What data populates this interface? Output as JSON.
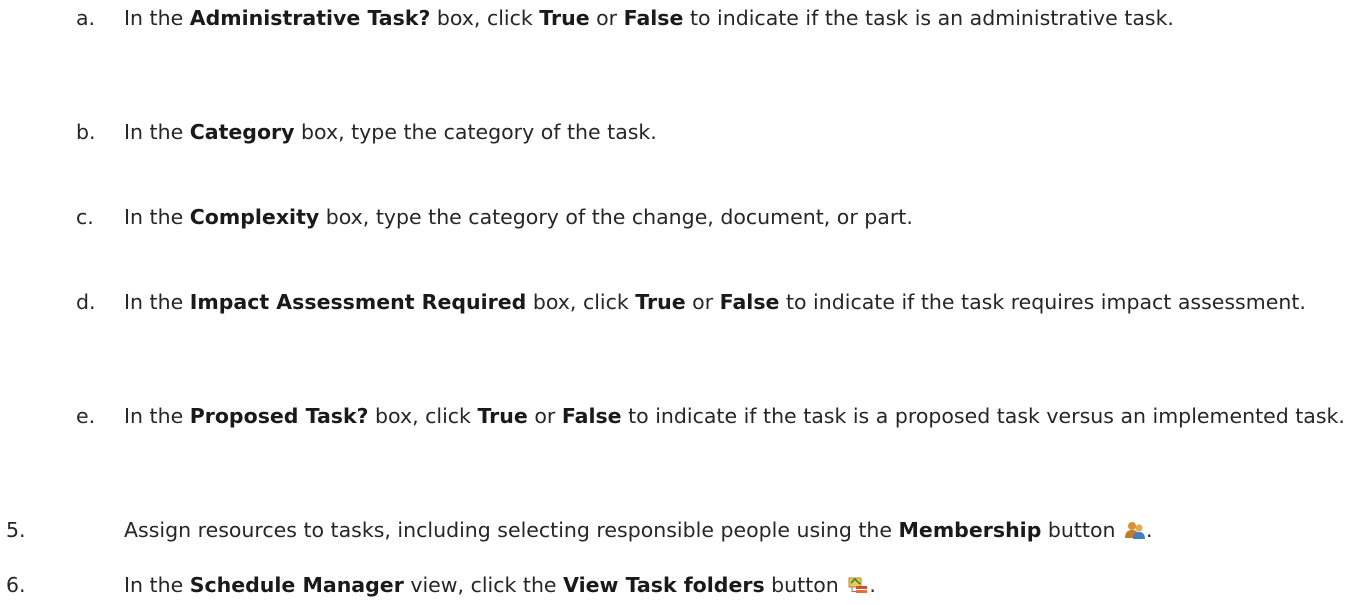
{
  "steps": {
    "a": {
      "num": "a.",
      "t1": "In the ",
      "b1": "Administrative Task?",
      "t2": " box, click ",
      "b2": "True",
      "t3": " or ",
      "b3": "False",
      "t4": " to indicate if the task is an administrative task."
    },
    "b": {
      "num": "b.",
      "t1": "In the ",
      "b1": "Category",
      "t2": " box, type the category of the task."
    },
    "c": {
      "num": "c.",
      "t1": "In the ",
      "b1": "Complexity",
      "t2": " box, type the category of the change, document, or part."
    },
    "d": {
      "num": "d.",
      "t1": "In the ",
      "b1": "Impact Assessment Required",
      "t2": " box, click ",
      "b2": "True",
      "t3": " or ",
      "b3": "False",
      "t4": " to indicate if the task requires impact assessment."
    },
    "e": {
      "num": "e.",
      "t1": "In the ",
      "b1": "Proposed Task?",
      "t2": " box, click ",
      "b2": "True",
      "t3": " or ",
      "b3": "False",
      "t4": " to indicate if the task is a proposed task versus an implemented task."
    },
    "five": {
      "num": "5.",
      "t1": "Assign resources to tasks, including selecting responsible people using the ",
      "b1": "Membership",
      "t2": " button ",
      "end": "."
    },
    "six": {
      "num": "6.",
      "t1": "In the ",
      "b1": "Schedule Manager",
      "t2": " view, click the ",
      "b2": "View Task folders",
      "t3": " button ",
      "end": "."
    }
  },
  "icons": {
    "membership": "membership-icon",
    "view_task_folders": "view-task-folders-icon"
  }
}
